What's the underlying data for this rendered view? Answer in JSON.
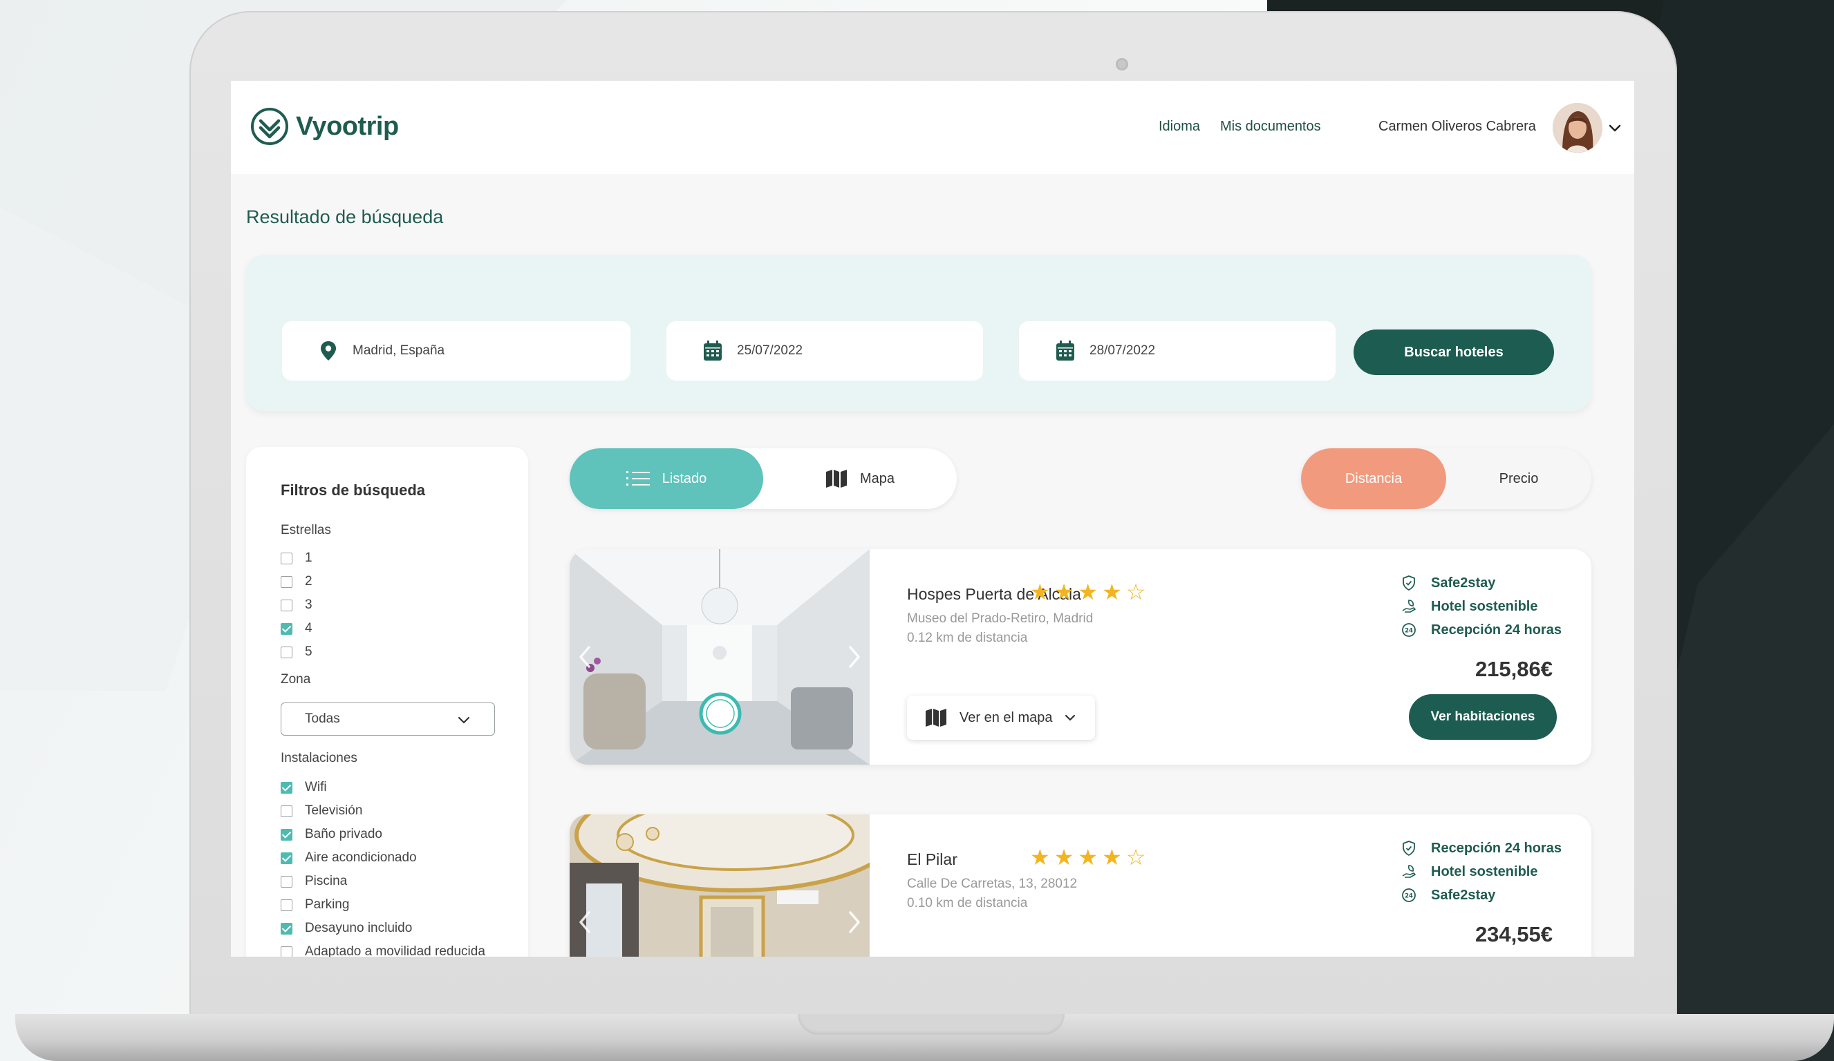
{
  "brand": {
    "name": "Vyootrip"
  },
  "header": {
    "nav": [
      "Idioma",
      "Mis documentos"
    ],
    "user_name": "Carmen Oliveros Cabrera"
  },
  "page_title": "Resultado de búsqueda",
  "search": {
    "location": "Madrid, España",
    "checkin": "25/07/2022",
    "checkout": "28/07/2022",
    "button": "Buscar hoteles"
  },
  "filters": {
    "title": "Filtros de búsqueda",
    "stars_label": "Estrellas",
    "stars": [
      {
        "label": "1",
        "checked": false
      },
      {
        "label": "2",
        "checked": false
      },
      {
        "label": "3",
        "checked": false
      },
      {
        "label": "4",
        "checked": true
      },
      {
        "label": "5",
        "checked": false
      }
    ],
    "zone_label": "Zona",
    "zone_value": "Todas",
    "facilities_label": "Instalaciones",
    "facilities": [
      {
        "label": "Wifi",
        "checked": true
      },
      {
        "label": "Televisión",
        "checked": false
      },
      {
        "label": "Baño privado",
        "checked": true
      },
      {
        "label": "Aire acondicionado",
        "checked": true
      },
      {
        "label": "Piscina",
        "checked": false
      },
      {
        "label": "Parking",
        "checked": false
      },
      {
        "label": "Desayuno incluido",
        "checked": true
      },
      {
        "label": "Adaptado a movilidad reducida",
        "checked": false
      }
    ]
  },
  "view_toggle": {
    "list": "Listado",
    "map": "Mapa",
    "active": "list"
  },
  "sort_toggle": {
    "distance": "Distancia",
    "price": "Precio",
    "active": "distance"
  },
  "hotels": [
    {
      "name": "Hospes Puerta de Alcala",
      "stars_filled": 4,
      "stars_total": 5,
      "address": "Museo del Prado-Retiro, Madrid",
      "distance": "0.12 km de distancia",
      "features": [
        {
          "icon": "shield-check-icon",
          "label": "Safe2stay"
        },
        {
          "icon": "leaf-hand-icon",
          "label": "Hotel sostenible"
        },
        {
          "icon": "clock-24-icon",
          "label": "Recepción 24 horas"
        }
      ],
      "price": "215,86€",
      "map_button": "Ver en el mapa",
      "rooms_button": "Ver habitaciones"
    },
    {
      "name": "El Pilar",
      "stars_filled": 4,
      "stars_total": 5,
      "address": "Calle De Carretas, 13, 28012",
      "distance": "0.10 km de distancia",
      "features": [
        {
          "icon": "shield-check-icon",
          "label": "Recepción 24 horas"
        },
        {
          "icon": "leaf-hand-icon",
          "label": "Hotel sostenible"
        },
        {
          "icon": "clock-24-icon",
          "label": "Safe2stay"
        }
      ],
      "price": "234,55€"
    }
  ],
  "colors": {
    "brand_dark": "#1d5c50",
    "accent_teal": "#5fc3bb",
    "accent_coral": "#f29a7e",
    "star": "#f2b520"
  }
}
